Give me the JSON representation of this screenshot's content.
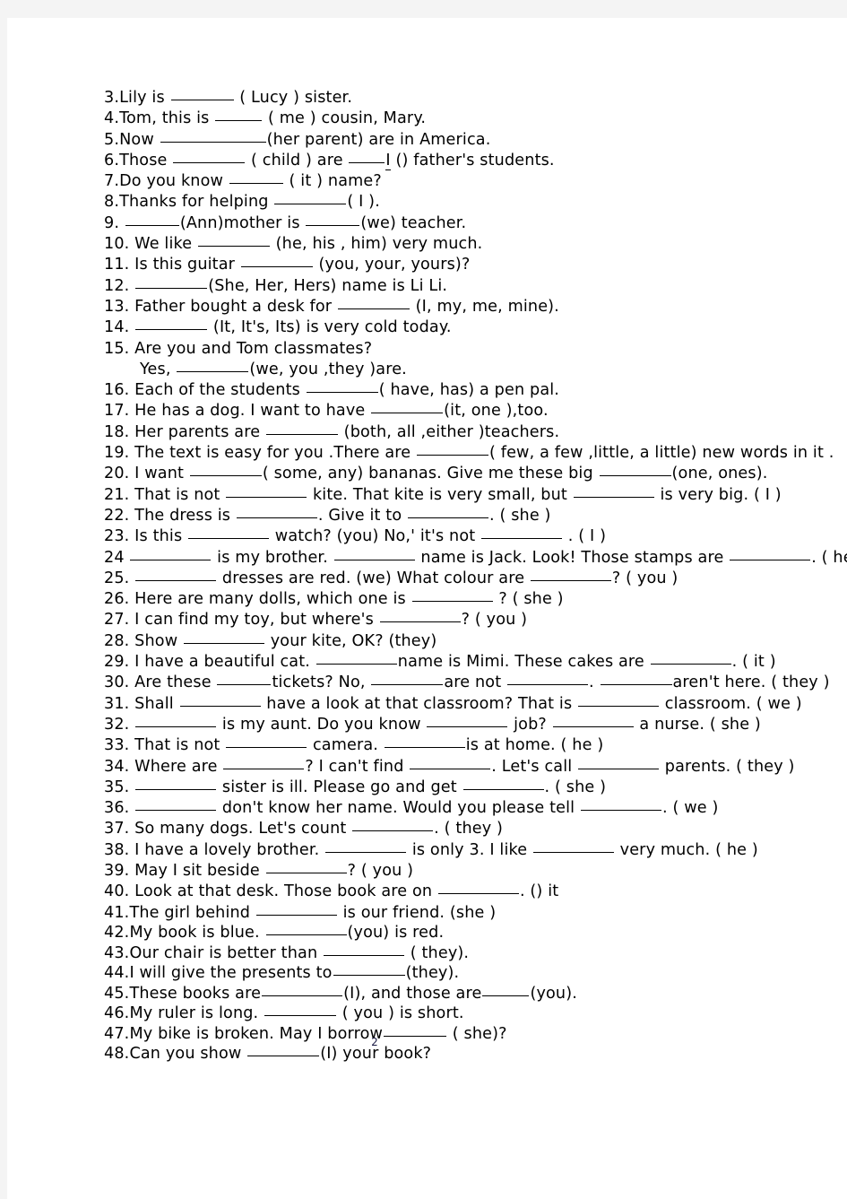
{
  "document": {
    "type": "worksheet",
    "subject": "English grammar — pronouns and possessive adjectives fill-in-the-blank",
    "page_number": "2",
    "page_background": "#ffffff",
    "canvas_background": "#f4f4f4",
    "text_color": "#000000"
  },
  "items": [
    {
      "num": "3.",
      "segments": [
        {
          "t": "text",
          "v": "Lily is "
        },
        {
          "t": "blank",
          "w": 7
        },
        {
          "t": "text",
          "v": " ( Lucy ) sister."
        }
      ]
    },
    {
      "num": "4.",
      "segments": [
        {
          "t": "text",
          "v": "Tom, this is "
        },
        {
          "t": "blank",
          "w": 5
        },
        {
          "t": "text",
          "v": " ( me ) cousin, Mary."
        }
      ]
    },
    {
      "num": "5.",
      "segments": [
        {
          "t": "text",
          "v": "Now "
        },
        {
          "t": "blank",
          "w": 12
        },
        {
          "t": "text",
          "v": "(her parent) are in America."
        }
      ]
    },
    {
      "num": "6.",
      "segments": [
        {
          "t": "text",
          "v": "Those "
        },
        {
          "t": "blank",
          "w": 8
        },
        {
          "t": "text",
          "v": " ( child ) are "
        },
        {
          "t": "blank",
          "w": 4
        },
        {
          "t": "ul",
          "v": "I"
        },
        {
          "t": "text",
          "v": " () father's students."
        }
      ]
    },
    {
      "num": "7.",
      "segments": [
        {
          "t": "text",
          "v": "Do you know  "
        },
        {
          "t": "blank",
          "w": 6
        },
        {
          "t": "text",
          "v": " ( it ) name?"
        }
      ]
    },
    {
      "num": "8.",
      "segments": [
        {
          "t": "text",
          "v": "Thanks for helping "
        },
        {
          "t": "blank",
          "w": 8
        },
        {
          "t": "text",
          "v": "( I )."
        }
      ]
    },
    {
      "num": "9.",
      "segments": [
        {
          "t": "text",
          "v": " "
        },
        {
          "t": "blank",
          "w": 6
        },
        {
          "t": "text",
          "v": "(Ann)mother is "
        },
        {
          "t": "blank",
          "w": 6
        },
        {
          "t": "text",
          "v": "(we) teacher."
        }
      ]
    },
    {
      "num": "10.",
      "segments": [
        {
          "t": "text",
          "v": " We like "
        },
        {
          "t": "blank",
          "w": 8
        },
        {
          "t": "text",
          "v": " (he, his , him) very much."
        }
      ]
    },
    {
      "num": "11.",
      "segments": [
        {
          "t": "text",
          "v": " Is this guitar "
        },
        {
          "t": "blank",
          "w": 8
        },
        {
          "t": "text",
          "v": " (you, your, yours)?"
        }
      ]
    },
    {
      "num": "12.",
      "segments": [
        {
          "t": "text",
          "v": " "
        },
        {
          "t": "blank",
          "w": 8
        },
        {
          "t": "text",
          "v": "(She, Her, Hers) name is Li Li."
        }
      ]
    },
    {
      "num": "13.",
      "segments": [
        {
          "t": "text",
          "v": " Father bought a desk for "
        },
        {
          "t": "blank",
          "w": 8
        },
        {
          "t": "text",
          "v": " (I, my, me, mine)."
        }
      ]
    },
    {
      "num": "14.",
      "segments": [
        {
          "t": "text",
          "v": " "
        },
        {
          "t": "blank",
          "w": 8
        },
        {
          "t": "text",
          "v": "  (It, It's, Its) is very cold today."
        }
      ]
    },
    {
      "num": "15.",
      "segments": [
        {
          "t": "text",
          "v": " Are you and Tom classmates?"
        }
      ]
    },
    {
      "num": "",
      "indent": true,
      "segments": [
        {
          "t": "text",
          "v": "Yes, "
        },
        {
          "t": "blank",
          "w": 8
        },
        {
          "t": "text",
          "v": "(we, you ,they )are."
        }
      ]
    },
    {
      "num": "16.",
      "segments": [
        {
          "t": "text",
          "v": " Each of the students "
        },
        {
          "t": "blank",
          "w": 8
        },
        {
          "t": "text",
          "v": "( have, has) a pen pal."
        }
      ]
    },
    {
      "num": "17.",
      "segments": [
        {
          "t": "text",
          "v": " He has a dog. I want to have "
        },
        {
          "t": "blank",
          "w": 8
        },
        {
          "t": "text",
          "v": "(it, one ),too."
        }
      ]
    },
    {
      "num": "18.",
      "segments": [
        {
          "t": "text",
          "v": " Her parents are "
        },
        {
          "t": "blank",
          "w": 8
        },
        {
          "t": "text",
          "v": " (both, all ,either )teachers."
        }
      ]
    },
    {
      "num": "19.",
      "segments": [
        {
          "t": "text",
          "v": " The text is easy for you .There are "
        },
        {
          "t": "blank",
          "w": 8
        },
        {
          "t": "text",
          "v": "( few, a few ,little, a little) new words in it ."
        }
      ]
    },
    {
      "num": "20.",
      "segments": [
        {
          "t": "text",
          "v": " I want "
        },
        {
          "t": "blank",
          "w": 8
        },
        {
          "t": "text",
          "v": "( some, any) bananas. Give me these big "
        },
        {
          "t": "blank",
          "w": 8
        },
        {
          "t": "text",
          "v": "(one, ones)."
        }
      ]
    },
    {
      "num": "21.",
      "segments": [
        {
          "t": "text",
          "v": "  That is not "
        },
        {
          "t": "blank",
          "w": 9
        },
        {
          "t": "text",
          "v": " kite. That kite is very small, but "
        },
        {
          "t": "blank",
          "w": 9
        },
        {
          "t": "text",
          "v": " is very big. ( I )"
        }
      ]
    },
    {
      "num": "22.",
      "segments": [
        {
          "t": "text",
          "v": " The dress is "
        },
        {
          "t": "blank",
          "w": 9
        },
        {
          "t": "text",
          "v": ". Give it to "
        },
        {
          "t": "blank",
          "w": 9
        },
        {
          "t": "text",
          "v": ". ( she )"
        }
      ]
    },
    {
      "num": "23.",
      "segments": [
        {
          "t": "text",
          "v": " Is this "
        },
        {
          "t": "blank",
          "w": 9
        },
        {
          "t": "text",
          "v": " watch? (you) No,' it's not "
        },
        {
          "t": "blank",
          "w": 9
        },
        {
          "t": "text",
          "v": " . ( I )"
        }
      ]
    },
    {
      "num": "24",
      "segments": [
        {
          "t": "text",
          "v": " "
        },
        {
          "t": "blank",
          "w": 9
        },
        {
          "t": "text",
          "v": " is my brother. "
        },
        {
          "t": "blank",
          "w": 9
        },
        {
          "t": "text",
          "v": " name is Jack. Look! Those stamps are "
        },
        {
          "t": "blank",
          "w": 9
        },
        {
          "t": "text",
          "v": ". ( he )"
        }
      ]
    },
    {
      "num": "25.",
      "segments": [
        {
          "t": "text",
          "v": " "
        },
        {
          "t": "blank",
          "w": 9
        },
        {
          "t": "text",
          "v": " dresses are red. (we) What colour are "
        },
        {
          "t": "blank",
          "w": 9
        },
        {
          "t": "text",
          "v": "? ( you )"
        }
      ]
    },
    {
      "num": "26.",
      "segments": [
        {
          "t": "text",
          "v": " Here are many dolls, which one is "
        },
        {
          "t": "blank",
          "w": 9
        },
        {
          "t": "text",
          "v": " ? ( she )"
        }
      ]
    },
    {
      "num": "27.",
      "segments": [
        {
          "t": "text",
          "v": " I can find my toy, but where's "
        },
        {
          "t": "blank",
          "w": 9
        },
        {
          "t": "text",
          "v": "? ( you )"
        }
      ]
    },
    {
      "num": "28.",
      "segments": [
        {
          "t": "text",
          "v": " Show "
        },
        {
          "t": "blank",
          "w": 9
        },
        {
          "t": "text",
          "v": " your kite, OK? (they)"
        }
      ]
    },
    {
      "num": "29.",
      "segments": [
        {
          "t": "text",
          "v": " I have a beautiful cat. "
        },
        {
          "t": "blank",
          "w": 9
        },
        {
          "t": "text",
          "v": "name is Mimi. These cakes are "
        },
        {
          "t": "blank",
          "w": 9
        },
        {
          "t": "text",
          "v": ". ( it )"
        }
      ]
    },
    {
      "num": "30.",
      "segments": [
        {
          "t": "text",
          "v": " Are these "
        },
        {
          "t": "blank",
          "w": 6
        },
        {
          "t": "text",
          "v": "tickets? No, "
        },
        {
          "t": "blank",
          "w": 8
        },
        {
          "t": "text",
          "v": "are not "
        },
        {
          "t": "blank",
          "w": 9
        },
        {
          "t": "text",
          "v": ". "
        },
        {
          "t": "blank",
          "w": 8
        },
        {
          "t": "text",
          "v": "aren't here. ( they )"
        }
      ]
    },
    {
      "num": "31.",
      "segments": [
        {
          "t": "text",
          "v": " Shall "
        },
        {
          "t": "blank",
          "w": 9
        },
        {
          "t": "text",
          "v": " have a look at that classroom? That is "
        },
        {
          "t": "blank",
          "w": 9
        },
        {
          "t": "text",
          "v": " classroom. ( we )"
        }
      ]
    },
    {
      "num": "32.",
      "segments": [
        {
          "t": "text",
          "v": " "
        },
        {
          "t": "blank",
          "w": 9
        },
        {
          "t": "text",
          "v": " is my aunt. Do you know "
        },
        {
          "t": "blank",
          "w": 9
        },
        {
          "t": "text",
          "v": " job? "
        },
        {
          "t": "blank",
          "w": 9
        },
        {
          "t": "text",
          "v": " a nurse. ( she )"
        }
      ]
    },
    {
      "num": "33.",
      "segments": [
        {
          "t": "text",
          "v": " That is not "
        },
        {
          "t": "blank",
          "w": 9
        },
        {
          "t": "text",
          "v": " camera. "
        },
        {
          "t": "blank",
          "w": 9
        },
        {
          "t": "text",
          "v": "is at home. ( he )"
        }
      ]
    },
    {
      "num": "34.",
      "segments": [
        {
          "t": "text",
          "v": " Where are "
        },
        {
          "t": "blank",
          "w": 9
        },
        {
          "t": "text",
          "v": "? I can't find "
        },
        {
          "t": "blank",
          "w": 9
        },
        {
          "t": "text",
          "v": ". Let's call "
        },
        {
          "t": "blank",
          "w": 9
        },
        {
          "t": "text",
          "v": " parents. ( they )"
        }
      ]
    },
    {
      "num": "35.",
      "segments": [
        {
          "t": "text",
          "v": " "
        },
        {
          "t": "blank",
          "w": 9
        },
        {
          "t": "text",
          "v": " sister is ill. Please go and get "
        },
        {
          "t": "blank",
          "w": 9
        },
        {
          "t": "text",
          "v": ". ( she )"
        }
      ]
    },
    {
      "num": "36.",
      "segments": [
        {
          "t": "text",
          "v": " "
        },
        {
          "t": "blank",
          "w": 9
        },
        {
          "t": "text",
          "v": " don't know her name. Would you please tell "
        },
        {
          "t": "blank",
          "w": 9
        },
        {
          "t": "text",
          "v": ". ( we )"
        }
      ]
    },
    {
      "num": "37.",
      "segments": [
        {
          "t": "text",
          "v": " So many dogs. Let's count "
        },
        {
          "t": "blank",
          "w": 9
        },
        {
          "t": "text",
          "v": ". ( they )"
        }
      ]
    },
    {
      "num": "38.",
      "segments": [
        {
          "t": "text",
          "v": " I have a lovely brother. "
        },
        {
          "t": "blank",
          "w": 9
        },
        {
          "t": "text",
          "v": " is only 3. I like "
        },
        {
          "t": "blank",
          "w": 9
        },
        {
          "t": "text",
          "v": " very much. ( he )"
        }
      ]
    },
    {
      "num": "39.",
      "segments": [
        {
          "t": "text",
          "v": " May I sit beside "
        },
        {
          "t": "blank",
          "w": 9
        },
        {
          "t": "text",
          "v": "? ( you )"
        }
      ]
    },
    {
      "num": "40.",
      "segments": [
        {
          "t": "text",
          "v": " Look at that desk. Those book are on "
        },
        {
          "t": "blank",
          "w": 9
        },
        {
          "t": "text",
          "v": ". () it"
        }
      ]
    },
    {
      "num": "41.",
      "segments": [
        {
          "t": "text",
          "v": "The girl behind "
        },
        {
          "t": "blank",
          "w": 9
        },
        {
          "t": "text",
          "v": " is our friend. (she )"
        }
      ]
    },
    {
      "num": "42.",
      "segments": [
        {
          "t": "text",
          "v": "My book is blue. "
        },
        {
          "t": "blank",
          "w": 9
        },
        {
          "t": "text",
          "v": "(you) is red."
        }
      ]
    },
    {
      "num": "43.",
      "segments": [
        {
          "t": "text",
          "v": "Our chair is better than "
        },
        {
          "t": "blank",
          "w": 9
        },
        {
          "t": "text",
          "v": " ( they)."
        }
      ]
    },
    {
      "num": "44.",
      "segments": [
        {
          "t": "text",
          "v": "I will give the presents to"
        },
        {
          "t": "blank",
          "w": 8
        },
        {
          "t": "text",
          "v": "(they)."
        }
      ]
    },
    {
      "num": "45.",
      "segments": [
        {
          "t": "text",
          "v": "These books are"
        },
        {
          "t": "blank",
          "w": 9
        },
        {
          "t": "text",
          "v": "(I), and those are"
        },
        {
          "t": "blank",
          "w": 5
        },
        {
          "t": "text",
          "v": "(you)."
        }
      ]
    },
    {
      "num": "46.",
      "segments": [
        {
          "t": "text",
          "v": "My ruler is long. "
        },
        {
          "t": "blank",
          "w": 8
        },
        {
          "t": "text",
          "v": " ( you ) is short."
        }
      ]
    },
    {
      "num": "47.",
      "segments": [
        {
          "t": "text",
          "v": "My bike is broken. May I borrow"
        },
        {
          "t": "blank",
          "w": 7
        },
        {
          "t": "text",
          "v": " ( she)?"
        }
      ]
    },
    {
      "num": "48.",
      "segments": [
        {
          "t": "text",
          "v": "Can you show "
        },
        {
          "t": "blank",
          "w": 8
        },
        {
          "t": "text",
          "v": "(I) your book?"
        }
      ]
    }
  ]
}
